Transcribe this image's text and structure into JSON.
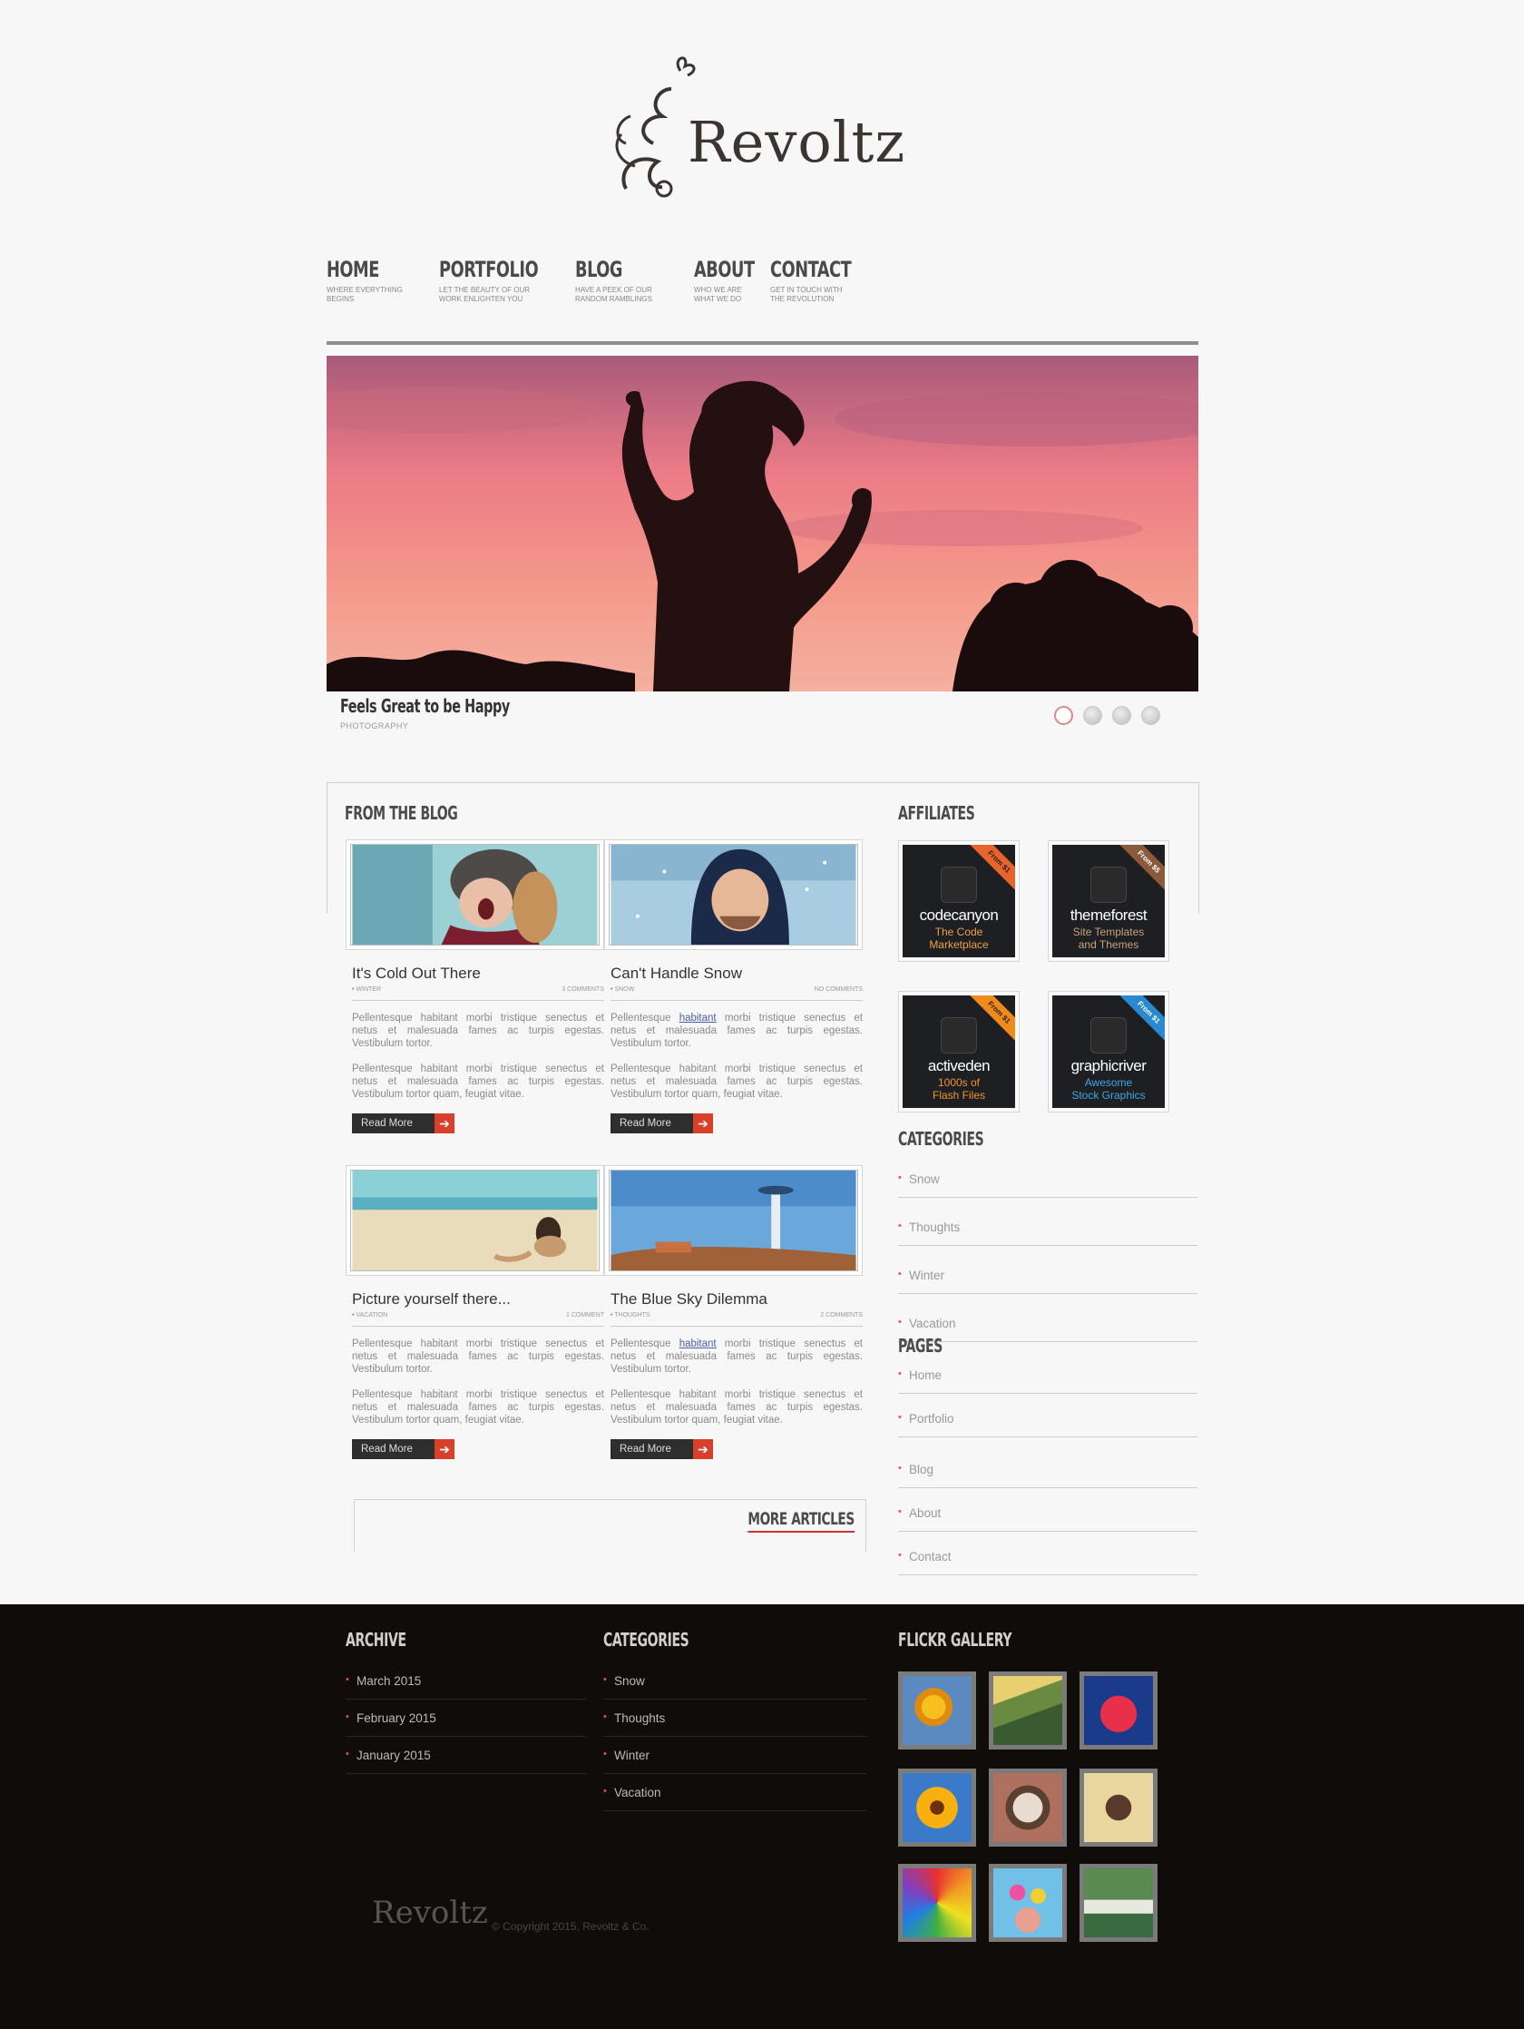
{
  "site": {
    "logo_text": "Revoltz"
  },
  "nav": [
    {
      "label": "HOME",
      "sub": "WHERE EVERYTHING BEGINS"
    },
    {
      "label": "PORTFOLIO",
      "sub": "LET THE BEAUTY OF OUR WORK ENLIGHTEN YOU"
    },
    {
      "label": "BLOG",
      "sub": "HAVE A PEEK OF OUR RANDOM RAMBLINGS"
    },
    {
      "label": "ABOUT",
      "sub": "WHO WE ARE WHAT WE DO"
    },
    {
      "label": "CONTACT",
      "sub": "GET IN TOUCH WITH THE REVOLUTION"
    }
  ],
  "slider": {
    "title": "Feels Great to be Happy",
    "category": "PHOTOGRAPHY",
    "active_slide": 1,
    "slide_count": 4
  },
  "blog": {
    "heading": "FROM THE BLOG",
    "read_more": "Read More",
    "more_articles": "MORE ARTICLES",
    "posts": [
      {
        "title": "It's Cold Out There",
        "category": "WINTER",
        "comments": "3 COMMENTS",
        "p1_a": "Pellentesque habitant morbi tristique senectus et netus et malesuada fames ac turpis egestas. Vestibulum tortor.",
        "p2": "Pellentesque habitant morbi tristique senectus et netus et malesuada fames ac turpis egestas. Vestibulum tortor quam, feugiat vitae."
      },
      {
        "title": "Can't Handle Snow",
        "category": "SNOW",
        "comments": "NO COMMENTS",
        "p1_pre": "Pellentesque",
        "p1_link": "habitant",
        "p1_post": "morbi tristique senectus et netus et malesuada fames ac turpis egestas. Vestibulum tortor.",
        "p2": "Pellentesque habitant morbi tristique senectus et netus et malesuada fames ac turpis egestas. Vestibulum tortor quam, feugiat vitae."
      },
      {
        "title": "Picture yourself there...",
        "category": "VACATION",
        "comments": "1 COMMENT",
        "p1_a": "Pellentesque habitant morbi tristique senectus et netus et malesuada fames ac turpis egestas. Vestibulum tortor.",
        "p2": "Pellentesque habitant morbi tristique senectus et netus et malesuada fames ac turpis egestas. Vestibulum tortor quam, feugiat vitae."
      },
      {
        "title": "The Blue Sky Dilemma",
        "category": "THOUGHTS",
        "comments": "2 COMMENTS",
        "p1_pre": "Pellentesque",
        "p1_link": "habitant",
        "p1_post": "morbi tristique senectus et netus et malesuada fames ac turpis egestas. Vestibulum tortor.",
        "p2": "Pellentesque habitant morbi tristique senectus et netus et malesuada fames ac turpis egestas. Vestibulum tortor quam, feugiat vitae."
      }
    ]
  },
  "affiliates": {
    "heading": "AFFILIATES",
    "items": [
      {
        "name": "codecanyon",
        "desc1": "The Code",
        "desc2": "Marketplace",
        "ribbon": "From $1",
        "ribbon_color": "#e8642c",
        "desc_color": "#f0a040"
      },
      {
        "name": "themeforest",
        "desc1": "Site Templates",
        "desc2": "and Themes",
        "ribbon": "From $5",
        "ribbon_color": "#8b5a3a",
        "desc_color": "#c9a27e"
      },
      {
        "name": "activeden",
        "desc1": "1000s of",
        "desc2": "Flash Files",
        "ribbon": "From $1",
        "ribbon_color": "#f08a1a",
        "desc_color": "#f0962a"
      },
      {
        "name": "graphicriver",
        "desc1": "Awesome",
        "desc2": "Stock Graphics",
        "ribbon": "From $1",
        "ribbon_color": "#2a8ad0",
        "desc_color": "#3aa8e8"
      }
    ]
  },
  "sidebar_categories": {
    "heading": "CATEGORIES",
    "items": [
      "Snow",
      "Thoughts",
      "Winter",
      "Vacation"
    ]
  },
  "sidebar_pages": {
    "heading": "PAGES",
    "items": [
      "Home",
      "Portfolio",
      "Blog",
      "About",
      "Contact"
    ]
  },
  "footer": {
    "archive": {
      "heading": "ARCHIVE",
      "items": [
        "March 2015",
        "February 2015",
        "January 2015"
      ]
    },
    "categories": {
      "heading": "CATEGORIES",
      "items": [
        "Snow",
        "Thoughts",
        "Winter",
        "Vacation"
      ]
    },
    "flickr": {
      "heading": "FLICKR GALLERY"
    },
    "logo_text": "Revoltz",
    "copyright": "© Copyright 2015, Revoltz & Co."
  }
}
